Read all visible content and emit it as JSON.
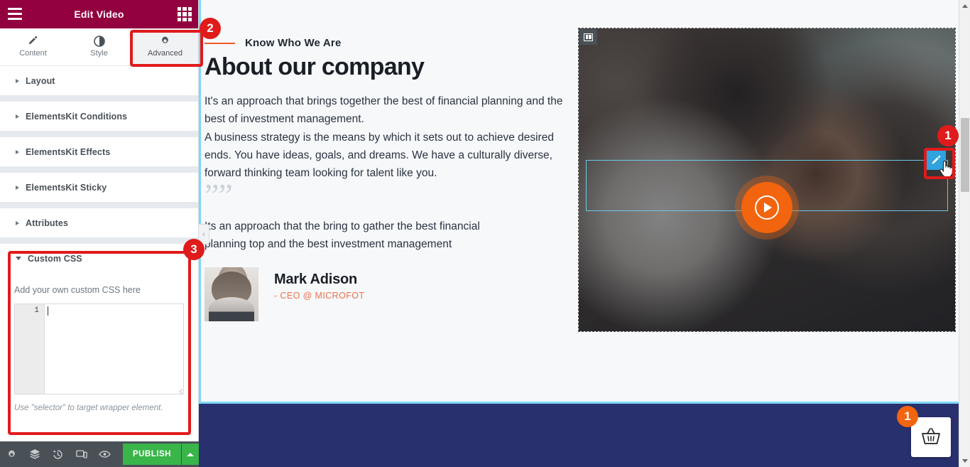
{
  "panel": {
    "header": {
      "title": "Edit Video",
      "menu_icon": "hamburger-icon",
      "apps_icon": "grid-apps-icon"
    },
    "tabs": [
      {
        "label": "Content",
        "icon": "pencil-icon",
        "active": false
      },
      {
        "label": "Style",
        "icon": "contrast-half-circle-icon",
        "active": false
      },
      {
        "label": "Advanced",
        "icon": "gear-icon",
        "active": true
      }
    ],
    "sections": [
      {
        "label": "Layout",
        "open": false
      },
      {
        "label": "ElementsKit Conditions",
        "open": false
      },
      {
        "label": "ElementsKit Effects",
        "open": false
      },
      {
        "label": "ElementsKit Sticky",
        "open": false
      },
      {
        "label": "Attributes",
        "open": false
      },
      {
        "label": "Custom CSS",
        "open": true
      }
    ],
    "custom_css": {
      "hint": "Add your own custom CSS here",
      "line_number": "1",
      "editor_value": "",
      "footnote": "Use \"selector\" to target wrapper element."
    },
    "footer": {
      "icons": [
        "settings-gear-icon",
        "layers-navigator-icon",
        "history-revisions-icon",
        "responsive-mode-icon",
        "preview-eye-icon"
      ],
      "publish_label": "PUBLISH",
      "publish_arrow_icon": "caret-up-icon"
    },
    "collapse_icon": "chevron-left-icon"
  },
  "canvas": {
    "about": {
      "eyebrow": "Know Who We Are",
      "title": "About our company",
      "paragraph_1": "It's an approach that brings together the best of financial planning and the best of investment management.",
      "paragraph_2": "A business strategy is the means by which it sets out to achieve desired ends. You have ideas, goals, and dreams. We have a culturally diverse, forward thinking team looking for talent like you."
    },
    "testimonial": {
      "quote_icon": "quotation-mark-icon",
      "quote": "Its an approach that the bring to gather the best financial planning top and the best investment management",
      "author_name": "Mark Adison",
      "author_role": "- CEO @ MICROFOT",
      "avatar_alt": "avatar"
    },
    "video_widget": {
      "column_handle_icon": "columns-layout-icon",
      "play_icon": "play-circle-icon",
      "edit_handle_icon": "pencil-edit-icon",
      "cursor_icon": "hand-pointer-cursor-icon"
    },
    "footer_strip": {
      "cart_icon": "shopping-basket-icon"
    },
    "scrollbar": {
      "up_icon": "scroll-up-arrow-icon",
      "down_icon": "scroll-down-arrow-icon"
    }
  },
  "annotations": [
    {
      "number": "1",
      "target": "video-edit-handle"
    },
    {
      "number": "2",
      "target": "advanced-tab"
    },
    {
      "number": "3",
      "target": "custom-css-section"
    },
    {
      "number": "1",
      "target": "floating-cart-button"
    }
  ],
  "colors": {
    "panel_header": "#93003f",
    "publish_green": "#39b54a",
    "accent_orange": "#f2640d",
    "annotation_red": "#e01b1b",
    "select_blue": "#2ea3dd",
    "footer_navy": "#28306e"
  }
}
